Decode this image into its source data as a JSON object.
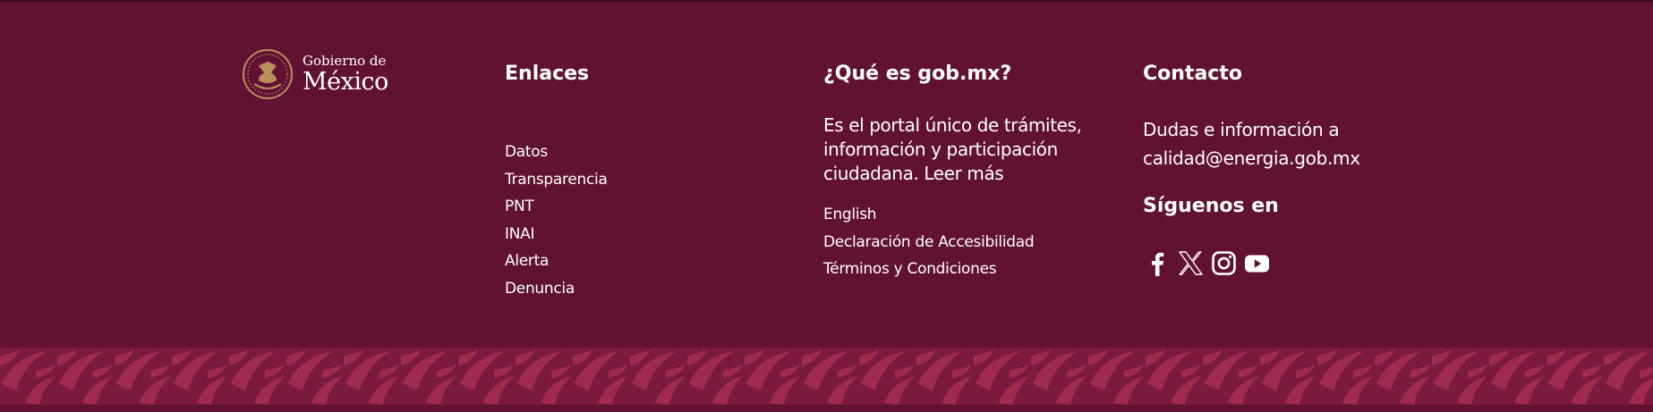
{
  "brand": {
    "logo_line1": "Gobierno de",
    "logo_line2": "México"
  },
  "links": {
    "title": "Enlaces",
    "items": [
      "Datos",
      "Transparencia",
      "PNT",
      "INAI",
      "Alerta",
      "Denuncia"
    ]
  },
  "que_es": {
    "title": "¿Qué es gob.mx?",
    "description": "Es el portal único de trámites, información y participación ciudadana.",
    "read_more": "Leer más",
    "items": [
      "English",
      "Declaración de Accesibilidad",
      "Términos y Condiciones"
    ]
  },
  "contact": {
    "title": "Contacto",
    "text_line1": "Dudas e información a",
    "email": "calidad@energia.gob.mx",
    "follow_title": "Síguenos en",
    "social_icons": [
      "facebook-icon",
      "x-icon",
      "instagram-icon",
      "youtube-icon"
    ]
  },
  "colors": {
    "background": "#611232",
    "pattern_base": "#7a1a3e",
    "pattern_leaf": "#a0294f",
    "text": "#ffffff",
    "seal": "#b8905a"
  }
}
